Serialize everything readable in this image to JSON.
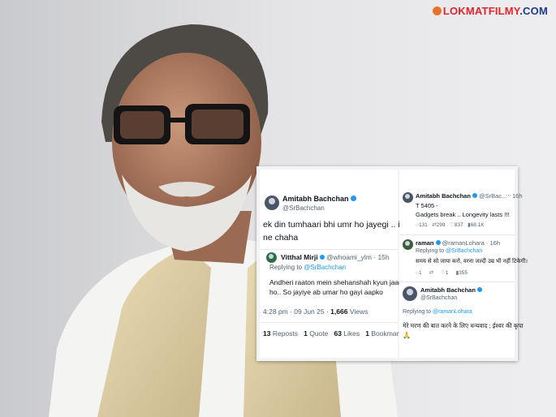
{
  "brand": {
    "part1": "LOKMAT",
    "part2": "FILMY",
    "part3": ".COM"
  },
  "left_card": {
    "author_name": "Amitabh Bachchan",
    "author_handle": "@SrBachchan",
    "tweet_line1": "ek din tumhaari bhi umr ho jayegi .. ishwar",
    "tweet_line2": "ne chaha",
    "quoted": {
      "name": "Vitthal Mirji",
      "handle": "@whoami_ylm · 15h",
      "replying_prefix": "Replying to",
      "replying_to": "@SrBachchan",
      "text_line1": "Andheri raaton mein shehanshah kyun jaag rahe",
      "text_line2": "ho.. So jayiye ab umar ho gayi aapko"
    },
    "timestamp": "4:28 pm · 09 Jun 25 · ",
    "views_count": "1,666",
    "views_label": " Views",
    "reposts_count": "13",
    "reposts_label": " Reposts",
    "quotes_count": "1",
    "quotes_label": " Quote",
    "likes_count": "63",
    "likes_label": " Likes",
    "bookmarks_count": "1",
    "bookmarks_label": " Bookmark"
  },
  "right_card": {
    "tweet1": {
      "name": "Amitabh Bachchan",
      "handle": "@SrBac... · 16h",
      "line1": "T 5405 -",
      "line2": "Gadgets break .. Longevity lasts !!!",
      "replies": "131",
      "reposts": "299",
      "likes": "837",
      "views": "68.1K"
    },
    "tweet2": {
      "name": "raman",
      "handle": "@ramanLohara · 16h",
      "replying_prefix": "Replying to",
      "replying_to": "@SrBachchan",
      "text": "समय से सो जाया करो, वरना जल्दी उम्र भी नहीं टिकेगी।",
      "replies": "1",
      "likes": "1",
      "views": "355"
    },
    "tweet3": {
      "name": "Amitabh Bachchan",
      "handle": "@SrBachchan",
      "replying_prefix": "Replying to",
      "replying_to": "@ramanLohara",
      "text_line1": "मेरे मरण की बात करने के लिए धन्यवाद ; ईश्वर की कृपा",
      "text_line2": "🙏"
    }
  }
}
